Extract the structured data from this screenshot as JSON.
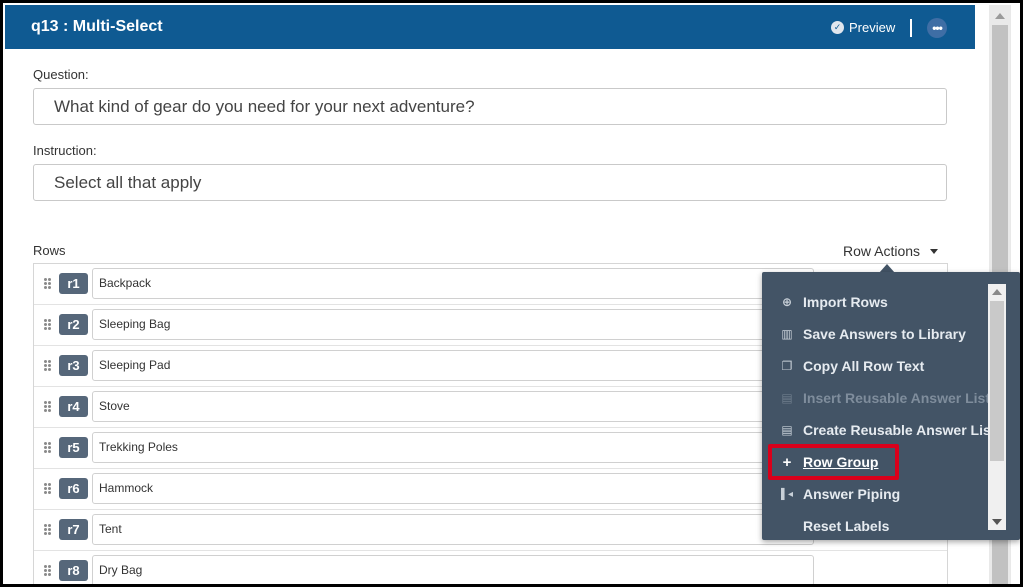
{
  "header": {
    "title": "q13 : Multi-Select",
    "preview_label": "Preview",
    "more_label": "•••"
  },
  "question": {
    "label": "Question:",
    "value": "What kind of gear do you need for your next adventure?"
  },
  "instruction": {
    "label": "Instruction:",
    "value": "Select all that apply"
  },
  "rows": {
    "label": "Rows",
    "actions_label": "Row Actions",
    "items": [
      {
        "id": "r1",
        "text": "Backpack"
      },
      {
        "id": "r2",
        "text": "Sleeping Bag"
      },
      {
        "id": "r3",
        "text": "Sleeping Pad"
      },
      {
        "id": "r4",
        "text": "Stove"
      },
      {
        "id": "r5",
        "text": "Trekking Poles"
      },
      {
        "id": "r6",
        "text": "Hammock"
      },
      {
        "id": "r7",
        "text": "Tent"
      },
      {
        "id": "r8",
        "text": "Dry Bag"
      }
    ]
  },
  "menu": {
    "items": [
      {
        "label": "Import Rows",
        "icon": "import-icon",
        "enabled": true
      },
      {
        "label": "Save Answers to Library",
        "icon": "library-icon",
        "enabled": true
      },
      {
        "label": "Copy All Row Text",
        "icon": "copy-icon",
        "enabled": true
      },
      {
        "label": "Insert Reusable Answer List",
        "icon": "clipboard-icon",
        "enabled": false
      },
      {
        "label": "Create Reusable Answer List",
        "icon": "clipboard-icon",
        "enabled": true
      },
      {
        "label": "Row Group",
        "icon": "plus-icon",
        "enabled": true,
        "highlighted": true
      },
      {
        "label": "Answer Piping",
        "icon": "piping-icon",
        "enabled": true
      },
      {
        "label": "Reset Labels",
        "icon": "",
        "enabled": true
      }
    ]
  },
  "colors": {
    "header_bg": "#0f5a92",
    "menu_bg": "#435466",
    "badge_bg": "#56677a",
    "highlight": "#d9001b"
  }
}
